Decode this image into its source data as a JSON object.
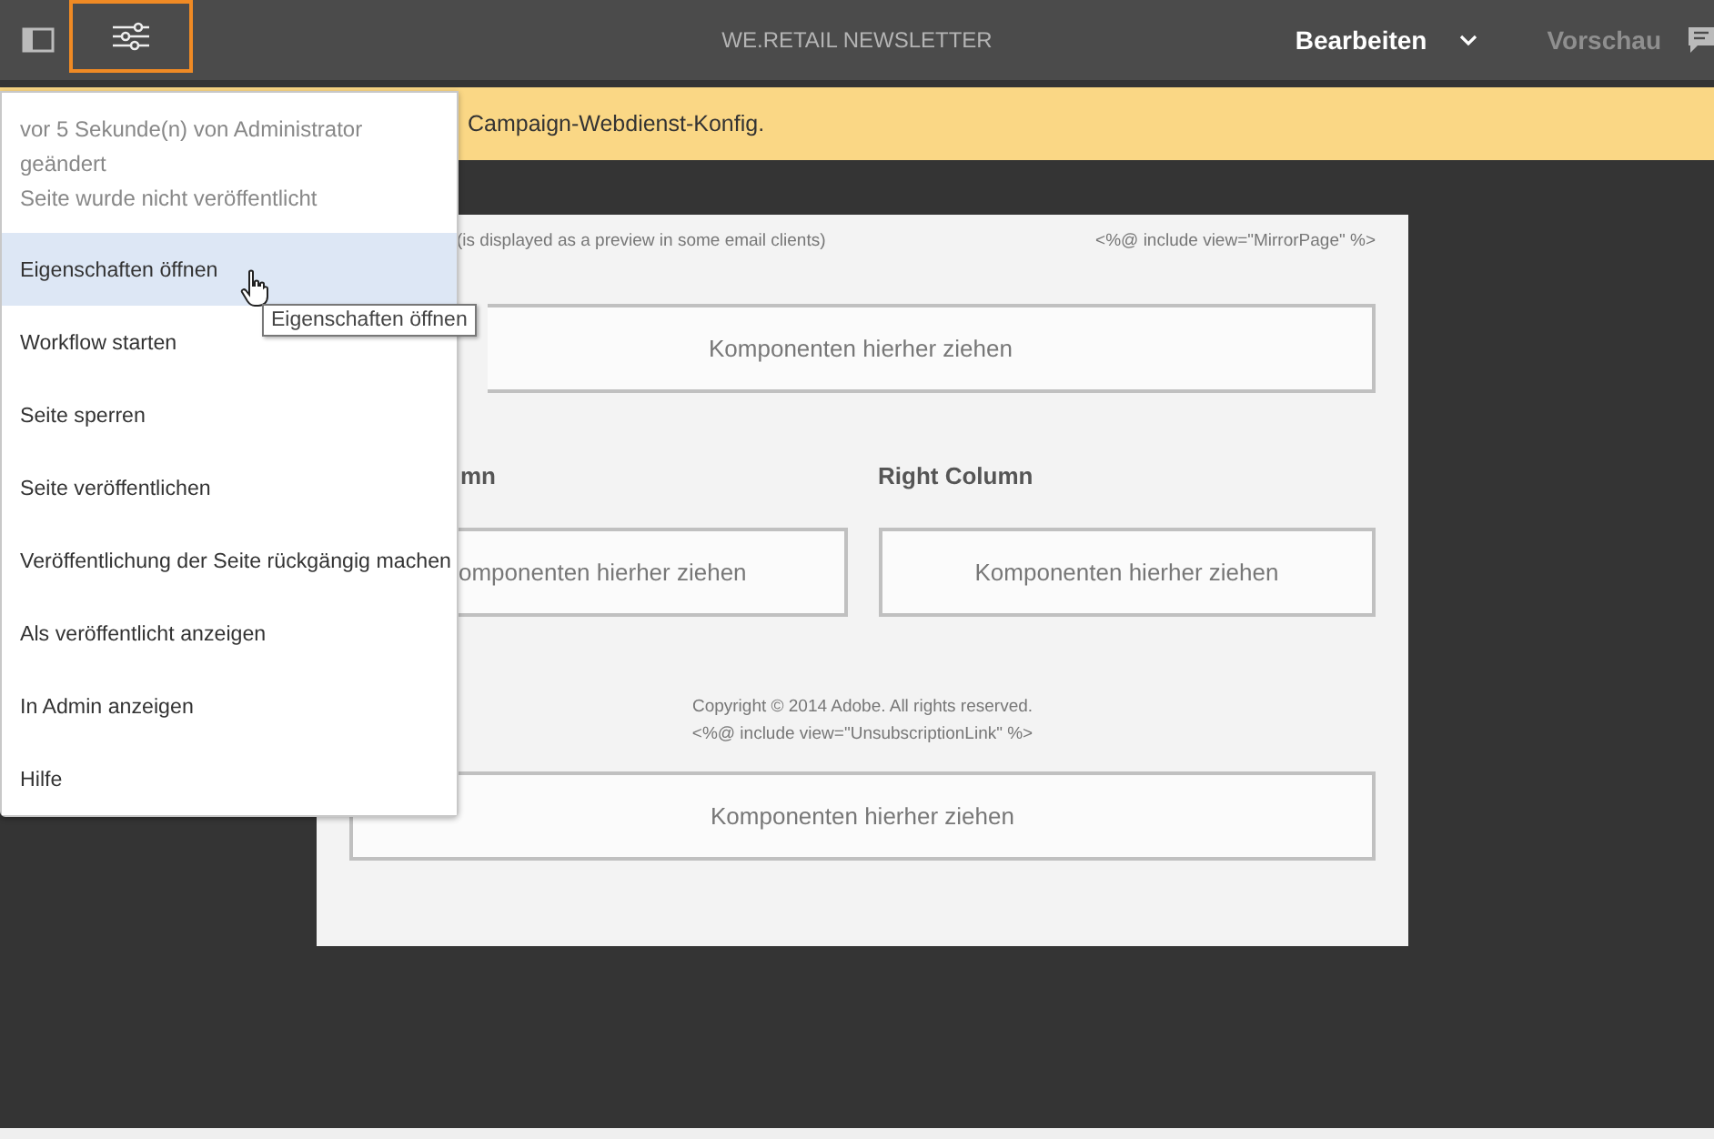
{
  "toolbar": {
    "title": "WE.RETAIL NEWSLETTER",
    "page_info_active": true,
    "mode": "Bearbeiten",
    "preview": "Vorschau"
  },
  "banner": {
    "text": "Campaign-Webdienst-Konfig."
  },
  "newsletter": {
    "preheader": "(is displayed as a preview in some email clients)",
    "mirror": "<%@ include view=\"MirrorPage\" %>",
    "top_dropzone": "Komponenten hierher ziehen",
    "columns": [
      {
        "heading": "mn",
        "dropzone": "omponenten hierher ziehen"
      },
      {
        "heading": "Right Column",
        "dropzone": "Komponenten hierher ziehen"
      }
    ],
    "footer": [
      "Copyright © 2014 Adobe. All rights reserved.",
      "<%@ include view=\"UnsubscriptionLink\" %>"
    ],
    "bottom_dropzone": "Komponenten hierher ziehen"
  },
  "page_menu": {
    "status": [
      "vor 5 Sekunde(n) von Administrator geändert",
      "Seite wurde nicht veröffentlicht"
    ],
    "items": [
      {
        "label": "Eigenschaften öffnen",
        "selected": true
      },
      {
        "label": "Workflow starten",
        "selected": false
      },
      {
        "label": "Seite sperren",
        "selected": false
      },
      {
        "label": "Seite veröffentlichen",
        "selected": false
      },
      {
        "label": "Veröffentlichung der Seite rückgängig machen",
        "selected": false
      },
      {
        "label": "Als veröffentlicht anzeigen",
        "selected": false
      },
      {
        "label": "In Admin anzeigen",
        "selected": false
      },
      {
        "label": "Hilfe",
        "selected": false
      }
    ],
    "tooltip": "Eigenschaften öffnen"
  }
}
